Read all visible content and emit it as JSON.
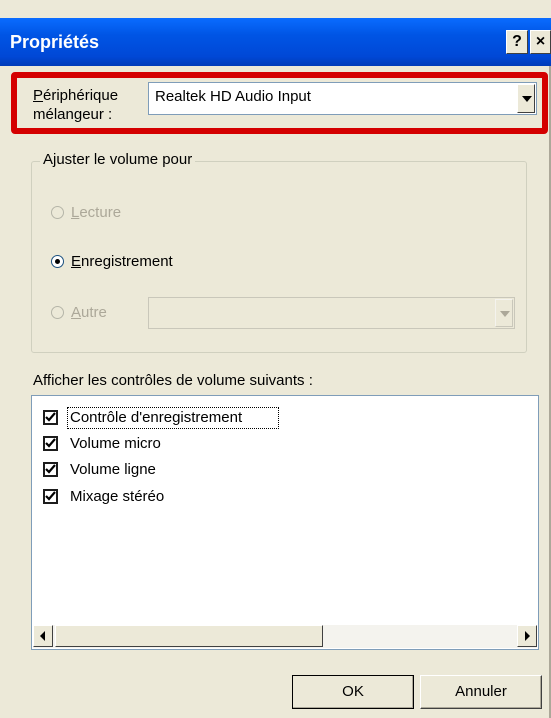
{
  "window": {
    "title": "Propriétés",
    "help_label": "?",
    "close_label": "×"
  },
  "mixer": {
    "label_line1": "Périphérique",
    "label_line2": "mélangeur :",
    "selected_device": "Realtek HD Audio Input"
  },
  "adjust_group": {
    "legend": "Ajuster le volume pour",
    "options": [
      {
        "label": "Lecture",
        "selected": false,
        "enabled": false
      },
      {
        "label": "Enregistrement",
        "selected": true,
        "enabled": true
      },
      {
        "label": "Autre",
        "selected": false,
        "enabled": false
      }
    ],
    "other_combo_value": ""
  },
  "controls_section": {
    "label": "Afficher les contrôles de volume suivants :",
    "items": [
      {
        "label": "Contrôle d'enregistrement",
        "checked": true
      },
      {
        "label": "Volume micro",
        "checked": true
      },
      {
        "label": "Volume ligne",
        "checked": true
      },
      {
        "label": "Mixage stéréo",
        "checked": true
      }
    ]
  },
  "buttons": {
    "ok": "OK",
    "cancel": "Annuler"
  },
  "colors": {
    "highlight": "#d40000",
    "titlebar": "#0055e5",
    "dialog_bg": "#ece9d8"
  }
}
